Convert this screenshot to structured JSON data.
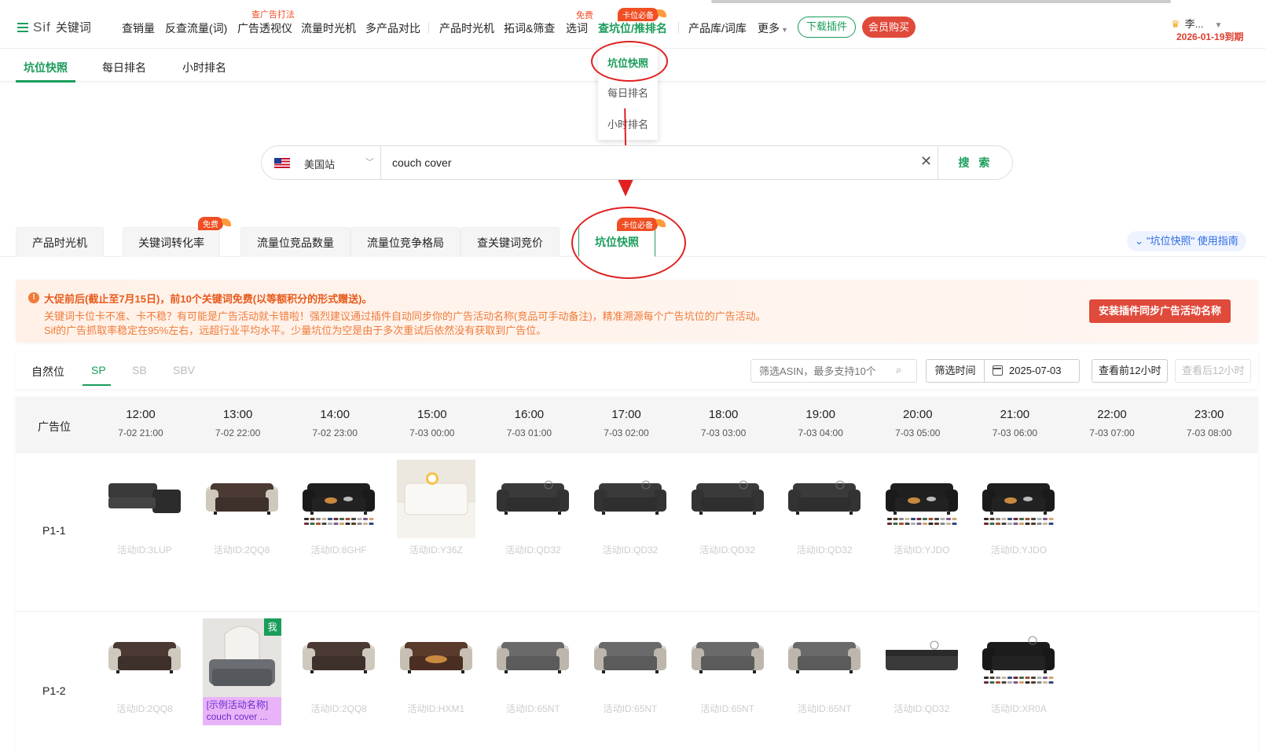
{
  "app": {
    "brand": "Sif",
    "brand_sub": "关键词"
  },
  "nav": {
    "items": [
      "查销量",
      "反查流量(词)",
      "广告透视仪",
      "流量时光机",
      "多产品对比",
      "产品时光机",
      "拓词&筛查",
      "选词",
      "查坑位/推排名",
      "产品库/词库",
      "更多"
    ],
    "active_index": 8,
    "tag_ad": "查广告打法",
    "tag_free": "免费",
    "tag_must": "卡位必备",
    "download_btn": "下载插件",
    "member_btn": "会员购买",
    "user_name": "李...",
    "expiry": "2026-01-19到期"
  },
  "subnav": {
    "items": [
      "坑位快照",
      "每日排名",
      "小时排名"
    ],
    "active_index": 0
  },
  "dropdown": {
    "items": [
      "坑位快照",
      "每日排名",
      "小时排名"
    ],
    "active_index": 0
  },
  "search": {
    "site": "美国站",
    "value": "couch cover",
    "button": "搜 索"
  },
  "feature_tabs": {
    "items": [
      "产品时光机",
      "关键词转化率",
      "流量位竞品数量",
      "流量位竞争格局",
      "查关键词竞价",
      "坑位快照"
    ],
    "active_index": 5,
    "badge_free": "免费",
    "badge_must": "卡位必备",
    "guide": "\"坑位快照\" 使用指南"
  },
  "notice": {
    "title": "大促前后(截止至7月15日)，前10个关键词免费(以等额积分的形式赠送)。",
    "line1": "关键词卡位卡不准、卡不稳？有可能是广告活动就卡错啦！强烈建议通过插件自动同步你的广告活动名称(竞品可手动备注)，精准溯源每个广告坑位的广告活动。",
    "line2": "Sif的广告抓取率稳定在95%左右，远超行业平均水平。少量坑位为空是由于多次重试后依然没有获取到广告位。",
    "button": "安装插件同步广告活动名称"
  },
  "filters": {
    "placement_tabs": [
      "自然位",
      "SP",
      "SB",
      "SBV"
    ],
    "active_index": 1,
    "asin_placeholder": "筛选ASIN，最多支持10个",
    "time_label": "筛选时间",
    "date": "2025-07-03",
    "prev_btn": "查看前12小时",
    "next_btn": "查看后12小时"
  },
  "grid": {
    "header_label": "广告位",
    "columns": [
      {
        "time": "12:00",
        "date": "7-02 21:00"
      },
      {
        "time": "13:00",
        "date": "7-02 22:00"
      },
      {
        "time": "14:00",
        "date": "7-02 23:00"
      },
      {
        "time": "15:00",
        "date": "7-03 00:00"
      },
      {
        "time": "16:00",
        "date": "7-03 01:00"
      },
      {
        "time": "17:00",
        "date": "7-03 02:00"
      },
      {
        "time": "18:00",
        "date": "7-03 03:00"
      },
      {
        "time": "19:00",
        "date": "7-03 04:00"
      },
      {
        "time": "20:00",
        "date": "7-03 05:00"
      },
      {
        "time": "21:00",
        "date": "7-03 06:00"
      },
      {
        "time": "22:00",
        "date": "7-03 07:00"
      },
      {
        "time": "23:00",
        "date": "7-03 08:00"
      }
    ],
    "rows": [
      {
        "label": "P1-1",
        "cells": [
          {
            "id": "活动ID:3LUP",
            "kind": "sectional-dark"
          },
          {
            "id": "活动ID:2QQ8",
            "kind": "cover-brown"
          },
          {
            "id": "活动ID:8GHF",
            "kind": "sofa-dog-swatch"
          },
          {
            "id": "活动ID:Y36Z",
            "kind": "photo-white"
          },
          {
            "id": "活动ID:QD32",
            "kind": "sofa-dark"
          },
          {
            "id": "活动ID:QD32",
            "kind": "sofa-dark"
          },
          {
            "id": "活动ID:QD32",
            "kind": "sofa-dark"
          },
          {
            "id": "活动ID:QD32",
            "kind": "sofa-dark"
          },
          {
            "id": "活动ID:YJDO",
            "kind": "sofa-dog-swatch"
          },
          {
            "id": "活动ID:YJDO",
            "kind": "sofa-dog-swatch"
          }
        ]
      },
      {
        "label": "P1-2",
        "cells": [
          {
            "id": "活动ID:2QQ8",
            "kind": "cover-brown"
          },
          {
            "id": "",
            "kind": "photo-gray",
            "me": "我",
            "label1": "[示例活动名称]",
            "label2": "couch cover ..."
          },
          {
            "id": "活动ID:2QQ8",
            "kind": "cover-brown"
          },
          {
            "id": "活动ID:HXM1",
            "kind": "cover-brown-dog"
          },
          {
            "id": "活动ID:65NT",
            "kind": "cover-gray"
          },
          {
            "id": "活动ID:65NT",
            "kind": "cover-gray"
          },
          {
            "id": "活动ID:65NT",
            "kind": "cover-gray"
          },
          {
            "id": "活动ID:65NT",
            "kind": "cover-gray"
          },
          {
            "id": "活动ID:QD32",
            "kind": "sofa-dark-flat"
          },
          {
            "id": "活动ID:XR0A",
            "kind": "sofa-black-swatch"
          }
        ]
      }
    ]
  }
}
